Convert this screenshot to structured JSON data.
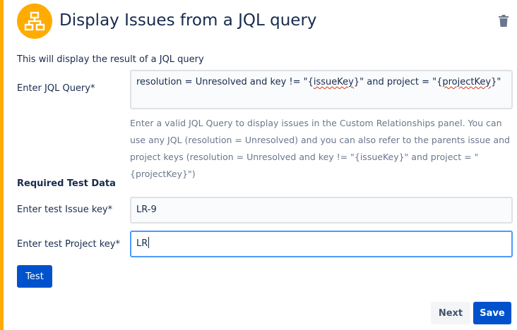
{
  "header": {
    "title": "Display Issues from a JQL query",
    "icon": "hierarchy-icon",
    "delete_icon": "trash-icon",
    "accent_color": "#ffab00"
  },
  "form": {
    "description": "This will display the result of a JQL query",
    "jql_label": "Enter JQL Query*",
    "jql_value_parts": [
      "resolution = Unresolved and key != \"{",
      "issueKey",
      "}\" and project = \"{",
      "projectKey",
      "}\""
    ],
    "help_lines": [
      "Enter a valid JQL Query to display issues in the Custom Relationships panel. You can",
      "use any JQL (resolution = Unresolved) and you can also refer to the parents issue and",
      "project keys (resolution = Unresolved and key != \"{issueKey}\" and project = \"",
      "{projectKey}\")"
    ],
    "test_data_heading": "Required Test Data",
    "issue_key_label": "Enter test Issue key*",
    "issue_key_value": "LR-9",
    "project_key_label": "Enter test Project key*",
    "project_key_value": "LR",
    "test_button": "Test"
  },
  "footer": {
    "next_button": "Next",
    "save_button": "Save"
  },
  "colors": {
    "primary": "#0052cc",
    "text": "#172b4d",
    "help_text": "#6b778c",
    "focus_border": "#4c9aff"
  }
}
